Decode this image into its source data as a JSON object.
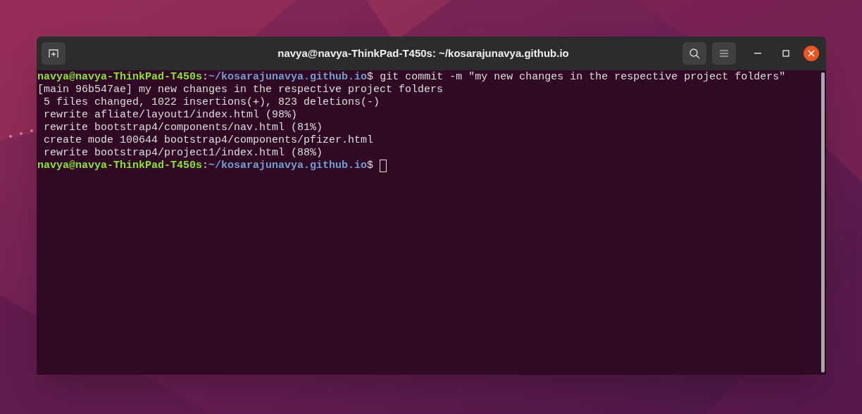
{
  "window": {
    "title": "navya@navya-ThinkPad-T450s: ~/kosarajunavya.github.io"
  },
  "terminal": {
    "lines": [
      {
        "kind": "prompt",
        "user_host": "navya@navya-ThinkPad-T450s",
        "separator": ":",
        "path": "~/kosarajunavya.github.io",
        "sigil": "$",
        "command": "git commit -m \"my new changes in the respective project folders\"",
        "cursor": false
      },
      {
        "kind": "output",
        "text": "[main 96b547ae] my new changes in the respective project folders"
      },
      {
        "kind": "output",
        "text": " 5 files changed, 1022 insertions(+), 823 deletions(-)"
      },
      {
        "kind": "output",
        "text": " rewrite afliate/layout1/index.html (98%)"
      },
      {
        "kind": "output",
        "text": " rewrite bootstrap4/components/nav.html (81%)"
      },
      {
        "kind": "output",
        "text": " create mode 100644 bootstrap4/components/pfizer.html"
      },
      {
        "kind": "output",
        "text": " rewrite bootstrap4/project1/index.html (88%)"
      },
      {
        "kind": "prompt",
        "user_host": "navya@navya-ThinkPad-T450s",
        "separator": ":",
        "path": "~/kosarajunavya.github.io",
        "sigil": "$",
        "cursor": true
      }
    ]
  }
}
